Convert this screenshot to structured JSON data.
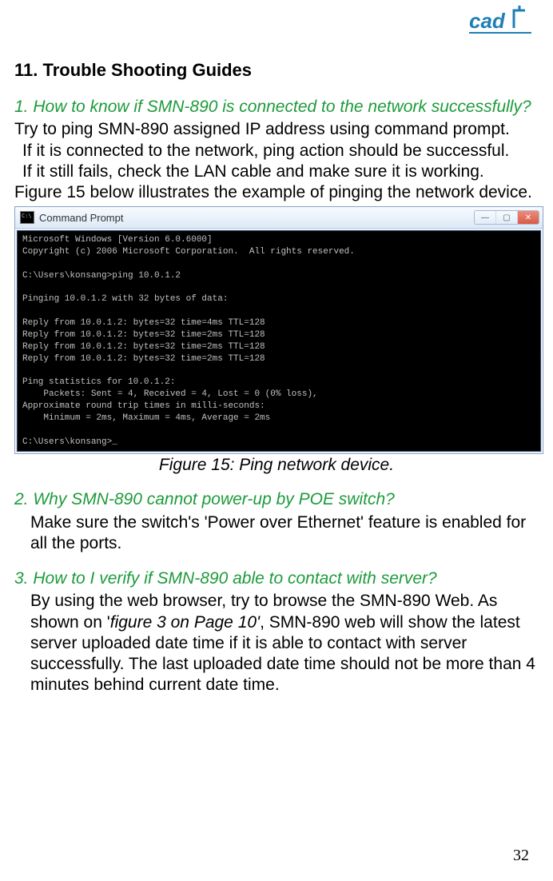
{
  "logo_text": "cad",
  "section_title": "11. Trouble Shooting Guides",
  "q1": "1. How to know if SMN-890 is connected to the network successfully?",
  "q1_body_a": " Try to ping SMN-890 assigned IP address using command prompt.",
  "q1_body_b": "If it is connected to the network, ping action should be successful.",
  "q1_body_c": "If it still fails, check the LAN cable and make sure it is working.",
  "q1_body_d": "Figure 15 below illustrates the example of pinging the network device.",
  "cmd_title": "Command Prompt",
  "cmd_lines": "Microsoft Windows [Version 6.0.6000]\nCopyright (c) 2006 Microsoft Corporation.  All rights reserved.\n\nC:\\Users\\konsang>ping 10.0.1.2\n\nPinging 10.0.1.2 with 32 bytes of data:\n\nReply from 10.0.1.2: bytes=32 time=4ms TTL=128\nReply from 10.0.1.2: bytes=32 time=2ms TTL=128\nReply from 10.0.1.2: bytes=32 time=2ms TTL=128\nReply from 10.0.1.2: bytes=32 time=2ms TTL=128\n\nPing statistics for 10.0.1.2:\n    Packets: Sent = 4, Received = 4, Lost = 0 (0% loss),\nApproximate round trip times in milli-seconds:\n    Minimum = 2ms, Maximum = 4ms, Average = 2ms\n\nC:\\Users\\konsang>_",
  "caption": "Figure 15: Ping network device.",
  "q2": "2. Why SMN-890 cannot power-up by POE switch?",
  "q2_body": "Make sure the switch's 'Power over Ethernet' feature is enabled for all the ports.",
  "q3": "3. How to I verify if SMN-890 able to contact with server?",
  "q3_body_a": "By using the web browser, try to browse the SMN-890 Web.  As shown on '",
  "q3_ref": "figure 3 on Page 10'",
  "q3_body_b": ", SMN-890 web will show the latest server uploaded date time if it is able to contact with server successfully. The last uploaded date time should not be more than 4 minutes behind current date time.",
  "page_number": "32",
  "win_min": "—",
  "win_max": "▢",
  "win_close": "✕"
}
